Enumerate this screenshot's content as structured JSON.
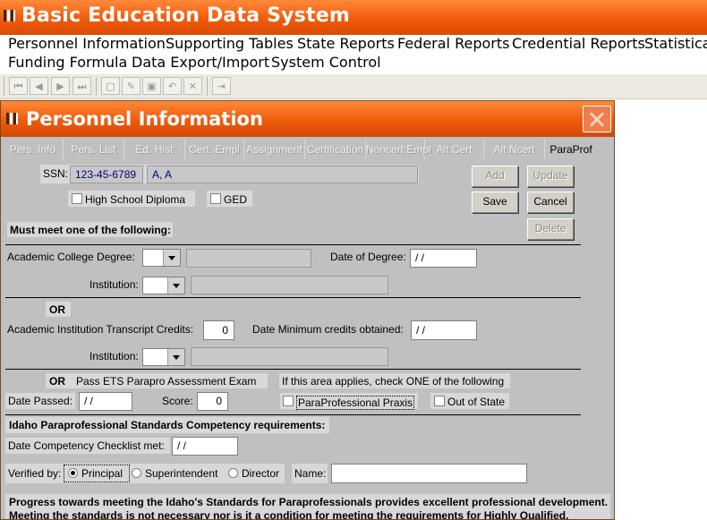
{
  "app": {
    "title": "Basic Education Data System"
  },
  "menu": [
    "Personnel Information",
    "Supporting Tables",
    "State Reports",
    "Federal Reports",
    "Credential Reports",
    "Statistical",
    "Funding Formula",
    "Data Export/Import",
    "System Control"
  ],
  "toolbar": {
    "first": "⏮",
    "prev": "◀",
    "next": "▶",
    "last": "⏭",
    "new": "▢",
    "edit": "✎",
    "save": "▣",
    "undo": "↶",
    "delete": "✕",
    "exit": "⇥"
  },
  "window": {
    "title": "Personnel Information"
  },
  "tabs": [
    {
      "label": "Pers. Info"
    },
    {
      "label": "Pers. List"
    },
    {
      "label": "Ed. Hist"
    },
    {
      "label": "Cert. Empl"
    },
    {
      "label": "Assignment"
    },
    {
      "label": "Certification"
    },
    {
      "label": "Noncert Empl"
    },
    {
      "label": "Alt Cert"
    },
    {
      "label": "Alt Ncert"
    },
    {
      "label": "ParaProf"
    }
  ],
  "form": {
    "ssn_label": "SSN:",
    "ssn_value": "123-45-6789",
    "name_value": "A, A",
    "hs_diploma": "High School Diploma",
    "ged": "GED",
    "must_meet": "Must meet one of the following:",
    "college_degree": "Academic College Degree:",
    "date_of_degree": "Date of Degree:",
    "date_of_degree_value": "/ /",
    "institution": "Institution:",
    "or": "OR",
    "transcript_credits": "Academic Institution Transcript Credits:",
    "credits_value": "0",
    "date_min_credits": "Date Minimum credits obtained:",
    "date_min_credits_value": "/ /",
    "ets_exam": "Pass ETS Parapro Assessment Exam",
    "applies_note": "If this area applies, check ONE of the following",
    "date_passed": "Date Passed:",
    "date_passed_value": "/ /",
    "score": "Score:",
    "score_value": "0",
    "praxis": "ParaProfessional Praxis",
    "out_of_state": "Out of State",
    "idaho_header": "Idaho Paraprofessional Standards Competency requirements:",
    "checklist_met": "Date Competency Checklist met:",
    "checklist_value": "/ /",
    "verified_by": "Verified by:",
    "principal": "Principal",
    "superintendent": "Superintendent",
    "director": "Director",
    "name_label": "Name:",
    "name_field_value": "",
    "progress_line1": "Progress towards meeting the Idaho's Standards for Paraprofessionals provides excellent professional development.",
    "progress_line2": "Meeting the standards is not necessary nor is it a condition for meeting the requirements for Highly Qualified."
  },
  "buttons": {
    "add": "Add",
    "update": "Update",
    "save": "Save",
    "cancel": "Cancel",
    "delete": "Delete"
  },
  "colors": {
    "titlebar": "#f25a0a",
    "form_bg": "#c0c0c0",
    "ssn_text": "#000080"
  }
}
